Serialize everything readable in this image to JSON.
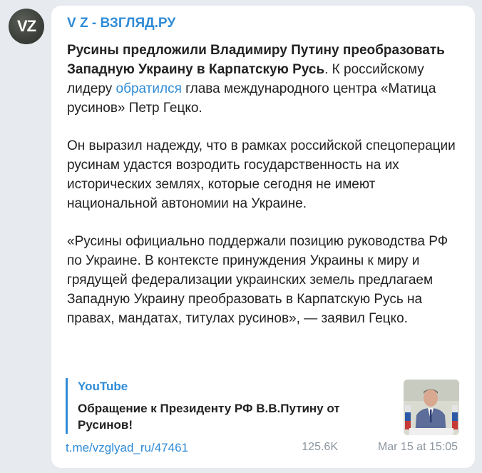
{
  "avatar": {
    "initials": "VZ"
  },
  "channel": {
    "name": "V Z - ВЗГЛЯД.РУ"
  },
  "message": {
    "headline": "Русины предложили Владимиру Путину преобразовать Западную Украину в Карпатскую Русь",
    "p1_after_headline": ". К российскому лидеру ",
    "p1_link": "обратился",
    "p1_end": " глава международного центра «Матица русинов» Петр Гецко.",
    "p2": "Он выразил надежду, что в рамках российской спецоперации русинам удастся возродить государственность на их исторических землях, которые сегодня не имеют национальной автономии на Украине.",
    "p3": "«Русины официально поддержали позицию руководства РФ по Украине. В контексте принуждения Украины к миру и грядущей федерализации украинских земель предлагаем Западную Украину преобразовать в Карпатскую Русь на правах, мандатах, титулах русинов», — заявил Гецко."
  },
  "link_preview": {
    "site": "YouTube",
    "title": "Обращение к Президенту РФ В.В.Путину от Русинов!"
  },
  "footer": {
    "post_link": "t.me/vzglyad_ru/47461",
    "views": "125.6K",
    "date": "Mar 15 at 15:05"
  },
  "colors": {
    "accent": "#2f8bd6",
    "background": "#e7ebf0",
    "meta_text": "#8c959e"
  },
  "icons": [
    "views-eye-icon"
  ]
}
